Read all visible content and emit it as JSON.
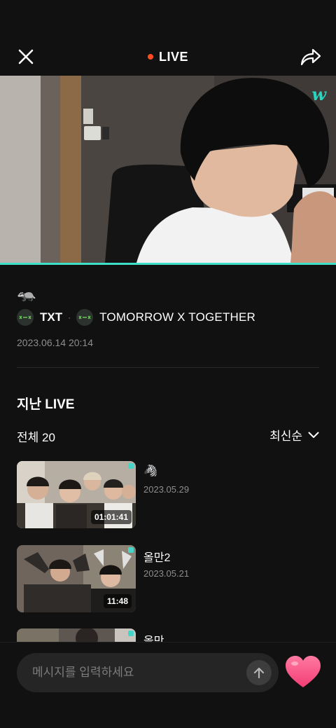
{
  "header": {
    "live_label": "LIVE",
    "live_dot_color": "#ff4b1f",
    "close_icon": "close-icon",
    "share_icon": "share-icon"
  },
  "player": {
    "brand_logo": "w",
    "accent_color": "#3ee0c8"
  },
  "live_info": {
    "title_emoji": "🦡",
    "artist_short": "TXT",
    "separator": "·",
    "artist_full": "TOMORROW X TOGETHER",
    "date": "2023.06.14 20:14"
  },
  "past_lives": {
    "section_title": "지난 LIVE",
    "count_label": "전체 20",
    "sort_label": "최신순",
    "items": [
      {
        "title": "🦓",
        "date": "2023.05.29",
        "duration": "01:01:41"
      },
      {
        "title": "올만2",
        "date": "2023.05.21",
        "duration": "11:48"
      },
      {
        "title": "올만",
        "date": "",
        "duration": ""
      }
    ]
  },
  "chat": {
    "placeholder": "메시지를 입력하세요",
    "send_icon": "arrow-up-icon",
    "heart_icon": "heart-icon"
  }
}
